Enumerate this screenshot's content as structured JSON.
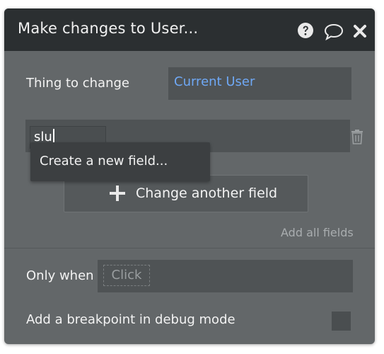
{
  "dialog": {
    "title": "Make changes to User...",
    "icons": [
      "help-icon",
      "comment-icon",
      "close-icon"
    ]
  },
  "thing_to_change": {
    "label": "Thing to change",
    "value": "Current User"
  },
  "field": {
    "typed_value": "slu",
    "dropdown_option": "Create a new field..."
  },
  "actions": {
    "change_another_field": "Change another field",
    "add_all_fields": "Add all fields"
  },
  "condition": {
    "label": "Only when",
    "placeholder": "Click"
  },
  "debug": {
    "label": "Add a breakpoint in debug mode",
    "checked": false
  },
  "colors": {
    "title_bar": "#2b2f31",
    "panel": "#636769",
    "input": "#4f5355",
    "link_value": "#6fa8f5"
  }
}
